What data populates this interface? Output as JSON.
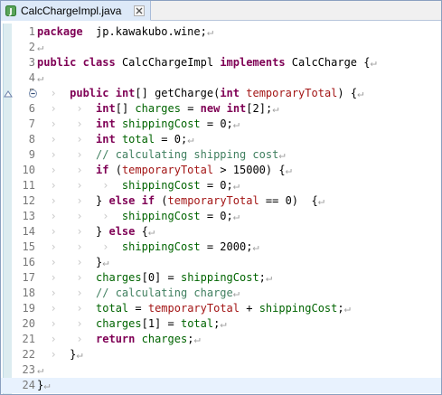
{
  "tab": {
    "label": "CalcChargeImpl.java",
    "icon": "java-file-icon",
    "close_icon": "close-icon"
  },
  "colors": {
    "keyword": "#7f0055",
    "comment": "#3f7f5f",
    "current_line": "#e8f2fe",
    "line_number": "#787878"
  },
  "editor": {
    "lines": [
      {
        "n": "1",
        "segs": [
          [
            "kw",
            "package"
          ],
          [
            "",
            "  jp.kawakubo.wine;"
          ],
          [
            "eol",
            "↵"
          ]
        ]
      },
      {
        "n": "2",
        "segs": [
          [
            "eol",
            "↵"
          ]
        ]
      },
      {
        "n": "3",
        "segs": [
          [
            "kw",
            "public"
          ],
          [
            "",
            " "
          ],
          [
            "kw",
            "class"
          ],
          [
            "",
            " CalcChargeImpl "
          ],
          [
            "kw",
            "implements"
          ],
          [
            "",
            " CalcCharge {"
          ],
          [
            "eol",
            "↵"
          ]
        ]
      },
      {
        "n": "4",
        "segs": [
          [
            "eol",
            "↵"
          ]
        ]
      },
      {
        "n": "5",
        "segs": [
          [
            "ws",
            "  ›  "
          ],
          [
            "kw",
            "public"
          ],
          [
            "",
            " "
          ],
          [
            "kw",
            "int"
          ],
          [
            "",
            "[] getCharge("
          ],
          [
            "kw",
            "int"
          ],
          [
            "",
            " "
          ],
          [
            "id-red",
            "temporaryTotal"
          ],
          [
            "",
            ") {"
          ],
          [
            "eol",
            "↵"
          ]
        ]
      },
      {
        "n": "6",
        "segs": [
          [
            "ws",
            "  ›   ›  "
          ],
          [
            "kw",
            "int"
          ],
          [
            "",
            "[] "
          ],
          [
            "id-green",
            "charges"
          ],
          [
            "",
            " = "
          ],
          [
            "kw",
            "new"
          ],
          [
            "",
            " "
          ],
          [
            "kw",
            "int"
          ],
          [
            "",
            "[2];"
          ],
          [
            "eol",
            "↵"
          ]
        ]
      },
      {
        "n": "7",
        "segs": [
          [
            "ws",
            "  ›   ›  "
          ],
          [
            "kw",
            "int"
          ],
          [
            "",
            " "
          ],
          [
            "id-green",
            "shippingCost"
          ],
          [
            "",
            " = 0;"
          ],
          [
            "eol",
            "↵"
          ]
        ]
      },
      {
        "n": "8",
        "segs": [
          [
            "ws",
            "  ›   ›  "
          ],
          [
            "kw",
            "int"
          ],
          [
            "",
            " "
          ],
          [
            "id-green",
            "total"
          ],
          [
            "",
            " = 0;"
          ],
          [
            "eol",
            "↵"
          ]
        ]
      },
      {
        "n": "9",
        "segs": [
          [
            "ws",
            "  ›   ›  "
          ],
          [
            "cmt",
            "// calculating shipping cost"
          ],
          [
            "eol",
            "↵"
          ]
        ]
      },
      {
        "n": "10",
        "segs": [
          [
            "ws",
            "  ›   ›  "
          ],
          [
            "kw",
            "if"
          ],
          [
            "",
            " ("
          ],
          [
            "id-red",
            "temporaryTotal"
          ],
          [
            "",
            " > 15000) {"
          ],
          [
            "eol",
            "↵"
          ]
        ]
      },
      {
        "n": "11",
        "segs": [
          [
            "ws",
            "  ›   ›   ›  "
          ],
          [
            "id-green",
            "shippingCost"
          ],
          [
            "",
            " = 0;"
          ],
          [
            "eol",
            "↵"
          ]
        ]
      },
      {
        "n": "12",
        "segs": [
          [
            "ws",
            "  ›   ›  "
          ],
          [
            "",
            "} "
          ],
          [
            "kw",
            "else"
          ],
          [
            "",
            " "
          ],
          [
            "kw",
            "if"
          ],
          [
            "",
            " ("
          ],
          [
            "id-red",
            "temporaryTotal"
          ],
          [
            "",
            " == 0)  {"
          ],
          [
            "eol",
            "↵"
          ]
        ]
      },
      {
        "n": "13",
        "segs": [
          [
            "ws",
            "  ›   ›   ›  "
          ],
          [
            "id-green",
            "shippingCost"
          ],
          [
            "",
            " = 0;"
          ],
          [
            "eol",
            "↵"
          ]
        ]
      },
      {
        "n": "14",
        "segs": [
          [
            "ws",
            "  ›   ›  "
          ],
          [
            "",
            "} "
          ],
          [
            "kw",
            "else"
          ],
          [
            "",
            " {"
          ],
          [
            "eol",
            "↵"
          ]
        ]
      },
      {
        "n": "15",
        "segs": [
          [
            "ws",
            "  ›   ›   ›  "
          ],
          [
            "id-green",
            "shippingCost"
          ],
          [
            "",
            " = 2000;"
          ],
          [
            "eol",
            "↵"
          ]
        ]
      },
      {
        "n": "16",
        "segs": [
          [
            "ws",
            "  ›   ›  "
          ],
          [
            "",
            "}"
          ],
          [
            "eol",
            "↵"
          ]
        ]
      },
      {
        "n": "17",
        "segs": [
          [
            "ws",
            "  ›   ›  "
          ],
          [
            "id-green",
            "charges"
          ],
          [
            "",
            "[0] = "
          ],
          [
            "id-green",
            "shippingCost"
          ],
          [
            "",
            ";"
          ],
          [
            "eol",
            "↵"
          ]
        ]
      },
      {
        "n": "18",
        "segs": [
          [
            "ws",
            "  ›   ›  "
          ],
          [
            "cmt",
            "// calculating charge"
          ],
          [
            "eol",
            "↵"
          ]
        ]
      },
      {
        "n": "19",
        "segs": [
          [
            "ws",
            "  ›   ›  "
          ],
          [
            "id-green",
            "total"
          ],
          [
            "",
            " = "
          ],
          [
            "id-red",
            "temporaryTotal"
          ],
          [
            "",
            " + "
          ],
          [
            "id-green",
            "shippingCost"
          ],
          [
            "",
            ";"
          ],
          [
            "eol",
            "↵"
          ]
        ]
      },
      {
        "n": "20",
        "segs": [
          [
            "ws",
            "  ›   ›  "
          ],
          [
            "id-green",
            "charges"
          ],
          [
            "",
            "[1] = "
          ],
          [
            "id-green",
            "total"
          ],
          [
            "",
            ";"
          ],
          [
            "eol",
            "↵"
          ]
        ]
      },
      {
        "n": "21",
        "segs": [
          [
            "ws",
            "  ›   ›  "
          ],
          [
            "kw",
            "return"
          ],
          [
            "",
            " "
          ],
          [
            "id-green",
            "charges"
          ],
          [
            "",
            ";"
          ],
          [
            "eol",
            "↵"
          ]
        ]
      },
      {
        "n": "22",
        "segs": [
          [
            "ws",
            "  ›  "
          ],
          [
            "",
            "}"
          ],
          [
            "eol",
            "↵"
          ]
        ]
      },
      {
        "n": "23",
        "segs": [
          [
            "eol",
            "↵"
          ]
        ]
      },
      {
        "n": "24",
        "segs": [
          [
            "",
            "}"
          ],
          [
            "eol",
            "↵"
          ]
        ]
      }
    ],
    "current_line": "24"
  }
}
